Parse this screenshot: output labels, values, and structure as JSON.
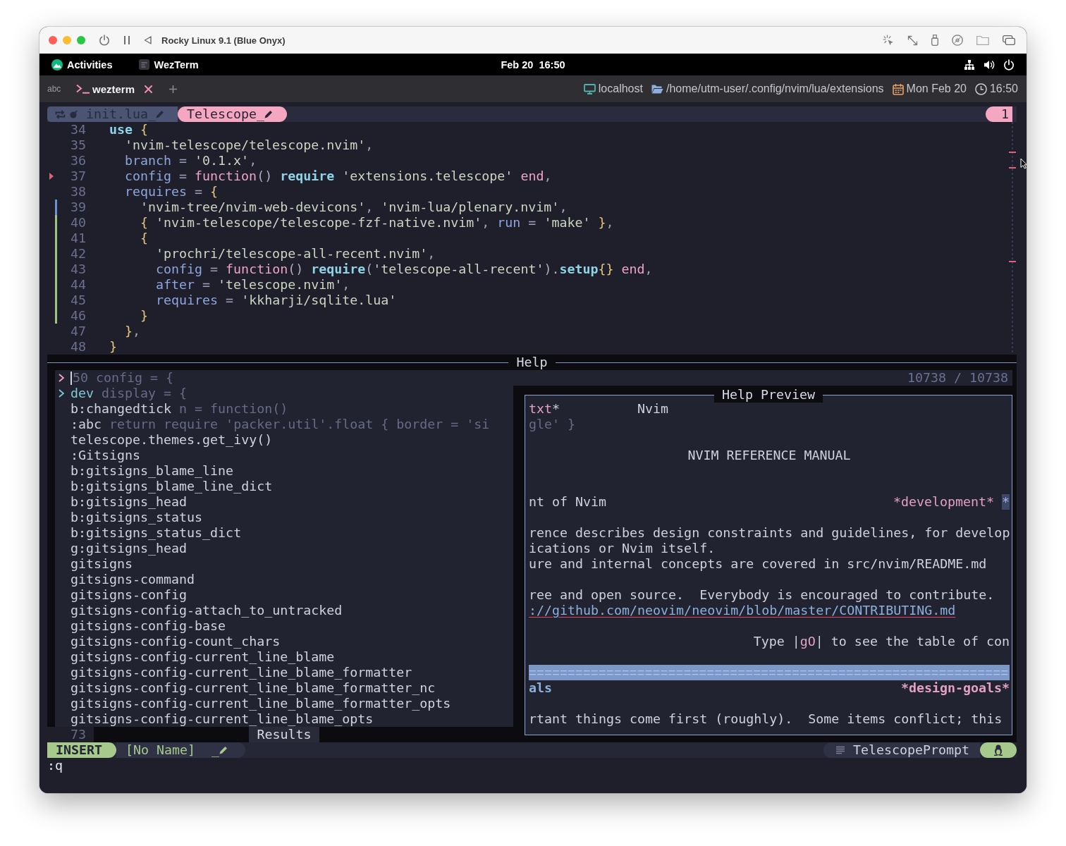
{
  "window": {
    "title": "Rocky Linux 9.1 (Blue Onyx)"
  },
  "top_bar": {
    "activities": "Activities",
    "app": "WezTerm",
    "clock": "Feb 20  16:50"
  },
  "terminal_bar": {
    "label": "abc",
    "tabs": [
      {
        "title": "wezterm",
        "selected": true
      }
    ],
    "status": [
      {
        "kind": "host",
        "text": "localhost"
      },
      {
        "kind": "folder",
        "text": "/home/utm-user/.config/nvim/lua/extensions"
      },
      {
        "kind": "date",
        "text": "Mon Feb 20"
      },
      {
        "kind": "time",
        "text": "16:50"
      }
    ]
  },
  "bufferline": {
    "buffers": [
      {
        "name": "init.lua_",
        "selected": false
      },
      {
        "name": "Telescope_",
        "selected": true
      }
    ],
    "tabpage": "1"
  },
  "editor": {
    "lines": [
      {
        "number": "34",
        "tokens": [
          {
            "text": "use",
            "kind": "keyword"
          },
          {
            "text": " {",
            "kind": "brace"
          }
        ],
        "children": [
          {
            "number": "35",
            "tokens": [
              {
                "text": "'nvim-telescope/telescope.nvim'",
                "kind": "string"
              },
              {
                "text": ",",
                "kind": "punct"
              }
            ]
          },
          {
            "number": "36",
            "tokens": [
              {
                "text": "branch",
                "kind": "field"
              },
              {
                "text": " = ",
                "kind": "op"
              },
              {
                "text": "'0.1.x'",
                "kind": "string"
              },
              {
                "text": ",",
                "kind": "punct"
              }
            ]
          },
          {
            "number": "37",
            "kind": "marked",
            "tokens": [
              {
                "text": "config",
                "kind": "field"
              },
              {
                "text": " = ",
                "kind": "op"
              },
              {
                "text": "function",
                "kind": "function"
              },
              {
                "text": "()",
                "kind": "paren"
              },
              {
                "text": " require",
                "kind": "keyword"
              },
              {
                "text": " 'extensions.telescope'",
                "kind": "string"
              },
              {
                "text": " end",
                "kind": "function"
              },
              {
                "text": ",",
                "kind": "punct"
              }
            ]
          },
          {
            "number": "38",
            "tokens": [
              {
                "text": "requires",
                "kind": "field"
              },
              {
                "text": " = ",
                "kind": "op"
              },
              {
                "text": "{",
                "kind": "brace"
              }
            ],
            "children": [
              {
                "number": "39",
                "kind": "changed",
                "tokens": [
                  {
                    "text": "'nvim-tree/nvim-web-devicons'",
                    "kind": "string"
                  },
                  {
                    "text": ", ",
                    "kind": "punct"
                  },
                  {
                    "text": "'nvim-lua/plenary.nvim'",
                    "kind": "string"
                  },
                  {
                    "text": ",",
                    "kind": "punct"
                  }
                ]
              },
              {
                "number": "40",
                "kind": "added",
                "tokens": [
                  {
                    "text": "{ ",
                    "kind": "brace"
                  },
                  {
                    "text": "'nvim-telescope/telescope-fzf-native.nvim'",
                    "kind": "string"
                  },
                  {
                    "text": ", ",
                    "kind": "punct"
                  },
                  {
                    "text": "run",
                    "kind": "field"
                  },
                  {
                    "text": " = ",
                    "kind": "op"
                  },
                  {
                    "text": "'make'",
                    "kind": "string"
                  },
                  {
                    "text": " }",
                    "kind": "brace"
                  },
                  {
                    "text": ",",
                    "kind": "punct"
                  }
                ]
              },
              {
                "number": "41",
                "kind": "added",
                "tokens": [
                  {
                    "text": "{",
                    "kind": "brace"
                  }
                ],
                "children": [
                  {
                    "number": "42",
                    "kind": "added",
                    "tokens": [
                      {
                        "text": "'prochri/telescope-all-recent.nvim'",
                        "kind": "string"
                      },
                      {
                        "text": ",",
                        "kind": "punct"
                      }
                    ]
                  },
                  {
                    "number": "43",
                    "kind": "added",
                    "tokens": [
                      {
                        "text": "config",
                        "kind": "field"
                      },
                      {
                        "text": " = ",
                        "kind": "op"
                      },
                      {
                        "text": "function",
                        "kind": "function"
                      },
                      {
                        "text": "()",
                        "kind": "paren"
                      },
                      {
                        "text": " require",
                        "kind": "keyword"
                      },
                      {
                        "text": "(",
                        "kind": "paren"
                      },
                      {
                        "text": "'telescope-all-recent'",
                        "kind": "string"
                      },
                      {
                        "text": ").",
                        "kind": "paren"
                      },
                      {
                        "text": "setup",
                        "kind": "keyword"
                      },
                      {
                        "text": "{}",
                        "kind": "brace"
                      },
                      {
                        "text": " end",
                        "kind": "function"
                      },
                      {
                        "text": ",",
                        "kind": "punct"
                      }
                    ]
                  },
                  {
                    "number": "44",
                    "kind": "added",
                    "tokens": [
                      {
                        "text": "after",
                        "kind": "field"
                      },
                      {
                        "text": " = ",
                        "kind": "op"
                      },
                      {
                        "text": "'telescope.nvim'",
                        "kind": "string"
                      },
                      {
                        "text": ",",
                        "kind": "punct"
                      }
                    ]
                  },
                  {
                    "number": "45",
                    "kind": "added",
                    "tokens": [
                      {
                        "text": "requires",
                        "kind": "field"
                      },
                      {
                        "text": " = ",
                        "kind": "op"
                      },
                      {
                        "text": "'kkharji/sqlite.lua'",
                        "kind": "string"
                      }
                    ]
                  }
                ]
              },
              {
                "number": "46",
                "kind": "added",
                "tokens": [
                  {
                    "text": "}",
                    "kind": "brace"
                  }
                ]
              }
            ]
          },
          {
            "number": "47",
            "tokens": [
              {
                "text": "}",
                "kind": "brace"
              },
              {
                "text": ",",
                "kind": "punct"
              }
            ]
          }
        ]
      },
      {
        "number": "48",
        "tokens": [
          {
            "text": "}",
            "kind": "brace"
          }
        ]
      }
    ]
  },
  "telescope": {
    "title": "Help",
    "prompt": {
      "background_text": "50 config = {",
      "counter": "10738 / 10738"
    },
    "results": [
      {
        "text": "dev",
        "selected": true,
        "background_text": "display = {"
      },
      {
        "text": "b:changedtick",
        "selected": false,
        "background_text": "n = function()"
      },
      {
        "text": ":abc",
        "selected": false,
        "background_text": "return require 'packer.util'.float { border = 'si"
      },
      {
        "text": "telescope.themes.get_ivy()",
        "selected": false
      },
      {
        "text": ":Gitsigns",
        "selected": false
      },
      {
        "text": "b:gitsigns_blame_line",
        "selected": false
      },
      {
        "text": "b:gitsigns_blame_line_dict",
        "selected": false
      },
      {
        "text": "b:gitsigns_head",
        "selected": false
      },
      {
        "text": "b:gitsigns_status",
        "selected": false
      },
      {
        "text": "b:gitsigns_status_dict",
        "selected": false
      },
      {
        "text": "g:gitsigns_head",
        "selected": false
      },
      {
        "text": "gitsigns",
        "selected": false
      },
      {
        "text": "gitsigns-command",
        "selected": false
      },
      {
        "text": "gitsigns-config",
        "selected": false
      },
      {
        "text": "gitsigns-config-attach_to_untracked",
        "selected": false
      },
      {
        "text": "gitsigns-config-base",
        "selected": false
      },
      {
        "text": "gitsigns-config-count_chars",
        "selected": false
      },
      {
        "text": "gitsigns-config-current_line_blame",
        "selected": false
      },
      {
        "text": "gitsigns-config-current_line_blame_formatter",
        "selected": false
      },
      {
        "text": "gitsigns-config-current_line_blame_formatter_nc",
        "selected": false
      },
      {
        "text": "gitsigns-config-current_line_blame_formatter_opts",
        "selected": false
      },
      {
        "text": "gitsigns-config-current_line_blame_opts",
        "selected": false
      }
    ],
    "results_title": "Results",
    "results_footer_background_text": "73",
    "preview": {
      "title": "Help Preview",
      "lines": [
        {
          "kind": "text",
          "segments": [
            {
              "text": "txt",
              "kind": "tag"
            },
            {
              "text": "*          Nvim",
              "kind": "plain"
            }
          ]
        },
        {
          "kind": "text",
          "segments": [
            {
              "text": "gle' }",
              "kind": "ghost"
            }
          ]
        },
        {
          "kind": "blank"
        },
        {
          "kind": "center",
          "segments": [
            {
              "text": "NVIM REFERENCE MANUAL",
              "kind": "plain"
            }
          ]
        },
        {
          "kind": "blank"
        },
        {
          "kind": "blank"
        },
        {
          "kind": "spread",
          "segments": [
            {
              "text": "nt of Nvim",
              "kind": "plain"
            },
            {
              "text": "*development*",
              "kind": "tag"
            },
            {
              "text": "*",
              "kind": "highlight"
            }
          ]
        },
        {
          "kind": "blank"
        },
        {
          "kind": "text",
          "segments": [
            {
              "text": "rence describes design constraints and guidelines, for develop",
              "kind": "plain"
            }
          ]
        },
        {
          "kind": "text",
          "segments": [
            {
              "text": "ications or Nvim itself.",
              "kind": "plain"
            }
          ]
        },
        {
          "kind": "text",
          "segments": [
            {
              "text": "ure and internal concepts are covered in src/nvim/README.md",
              "kind": "plain"
            }
          ]
        },
        {
          "kind": "blank"
        },
        {
          "kind": "text",
          "segments": [
            {
              "text": "ree and open source.  Everybody is encouraged to contribute.",
              "kind": "plain"
            }
          ]
        },
        {
          "kind": "text",
          "segments": [
            {
              "text": "://github.com/neovim/neovim/blob/master/CONTRIBUTING.md",
              "kind": "link"
            }
          ]
        },
        {
          "kind": "blank"
        },
        {
          "kind": "right",
          "segments": [
            {
              "text": "Type |",
              "kind": "plain"
            },
            {
              "text": "gO",
              "kind": "tag"
            },
            {
              "text": "| to see the table of con",
              "kind": "plain"
            }
          ]
        },
        {
          "kind": "blank"
        },
        {
          "kind": "rule",
          "segments": [
            {
              "text": "==============================================================",
              "kind": "rule"
            }
          ]
        },
        {
          "kind": "spread",
          "segments": [
            {
              "text": "als",
              "kind": "heading"
            },
            {
              "text": "*design-goals*",
              "kind": "heading_tag"
            }
          ]
        },
        {
          "kind": "blank"
        },
        {
          "kind": "text",
          "segments": [
            {
              "text": "rtant things come first (roughly).  Some items conflict; this",
              "kind": "plain"
            }
          ]
        }
      ]
    }
  },
  "statusline": {
    "mode": "INSERT",
    "file": "[No Name]",
    "modified_mark": "_",
    "filetype": "TelescopePrompt"
  },
  "cmdline": ":q"
}
